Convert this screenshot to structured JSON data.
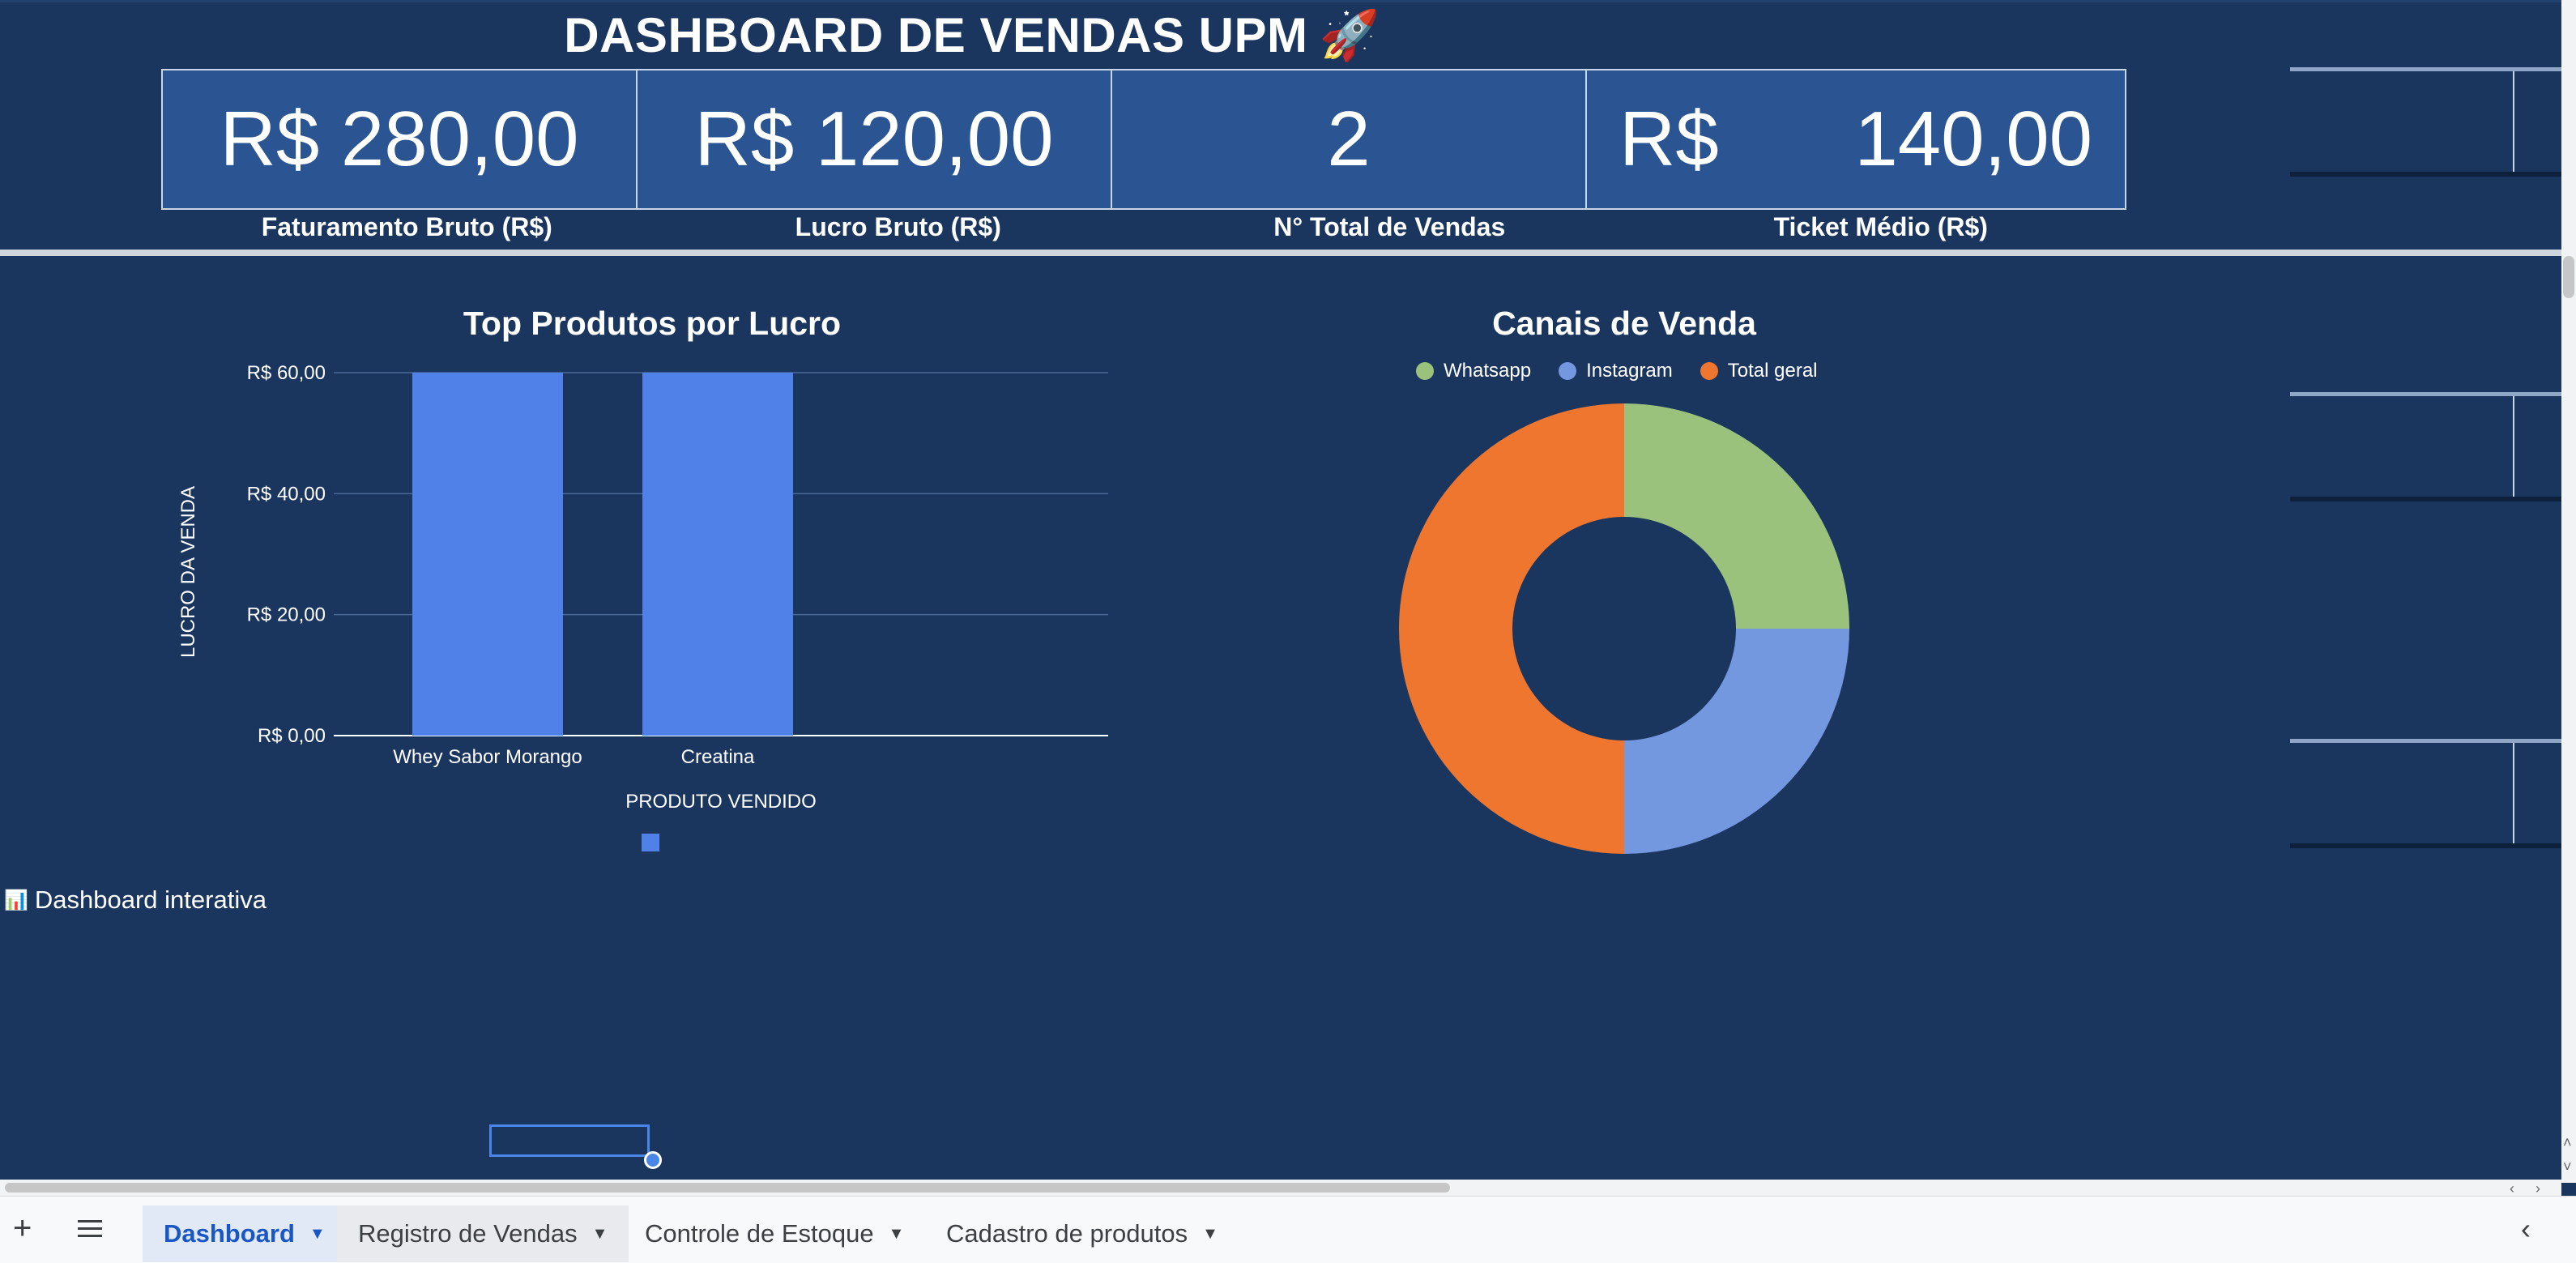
{
  "dashboard": {
    "title": "DASHBOARD DE VENDAS UPM",
    "title_icon": "🚀",
    "kpis": [
      {
        "value": "R$ 280,00",
        "label": "Faturamento Bruto (R$)"
      },
      {
        "value": "R$ 120,00",
        "label": "Lucro Bruto (R$)"
      },
      {
        "value": "2",
        "label": "N° Total de Vendas"
      },
      {
        "value_prefix": "R$",
        "value_amount": "140,00",
        "label": "Ticket Médio (R$)"
      }
    ],
    "note_icon": "📊",
    "note": "Dashboard interativa"
  },
  "chart_data": [
    {
      "type": "bar",
      "title": "Top Produtos por Lucro",
      "categories": [
        "Whey Sabor Morango",
        "Creatina"
      ],
      "values": [
        60,
        60
      ],
      "xlabel": "PRODUTO VENDIDO",
      "ylabel": "LUCRO DA VENDA",
      "ylim": [
        0,
        60
      ],
      "yticks": [
        "R$ 0,00",
        "R$ 20,00",
        "R$ 40,00",
        "R$ 60,00"
      ],
      "ytick_values": [
        0,
        20,
        40,
        60
      ],
      "color": "#4f81e8",
      "grid": true
    },
    {
      "type": "pie",
      "title": "Canais de Venda",
      "labels": [
        "Whatsapp",
        "Instagram",
        "Total geral"
      ],
      "values": [
        1,
        1,
        2
      ],
      "colors": [
        "#9ac27c",
        "#7498e0",
        "#ee762f"
      ],
      "legend": "top",
      "donut": true
    }
  ],
  "sheet_tabs": [
    {
      "label": "Dashboard",
      "active": true
    },
    {
      "label": "Registro de Vendas",
      "active": false
    },
    {
      "label": "Controle de Estoque",
      "active": false
    },
    {
      "label": "Cadastro de produtos",
      "active": false
    }
  ],
  "icons": {
    "add_sheet": "plus-icon",
    "all_sheets": "menu-icon",
    "collapse": "chevron-left-icon"
  }
}
